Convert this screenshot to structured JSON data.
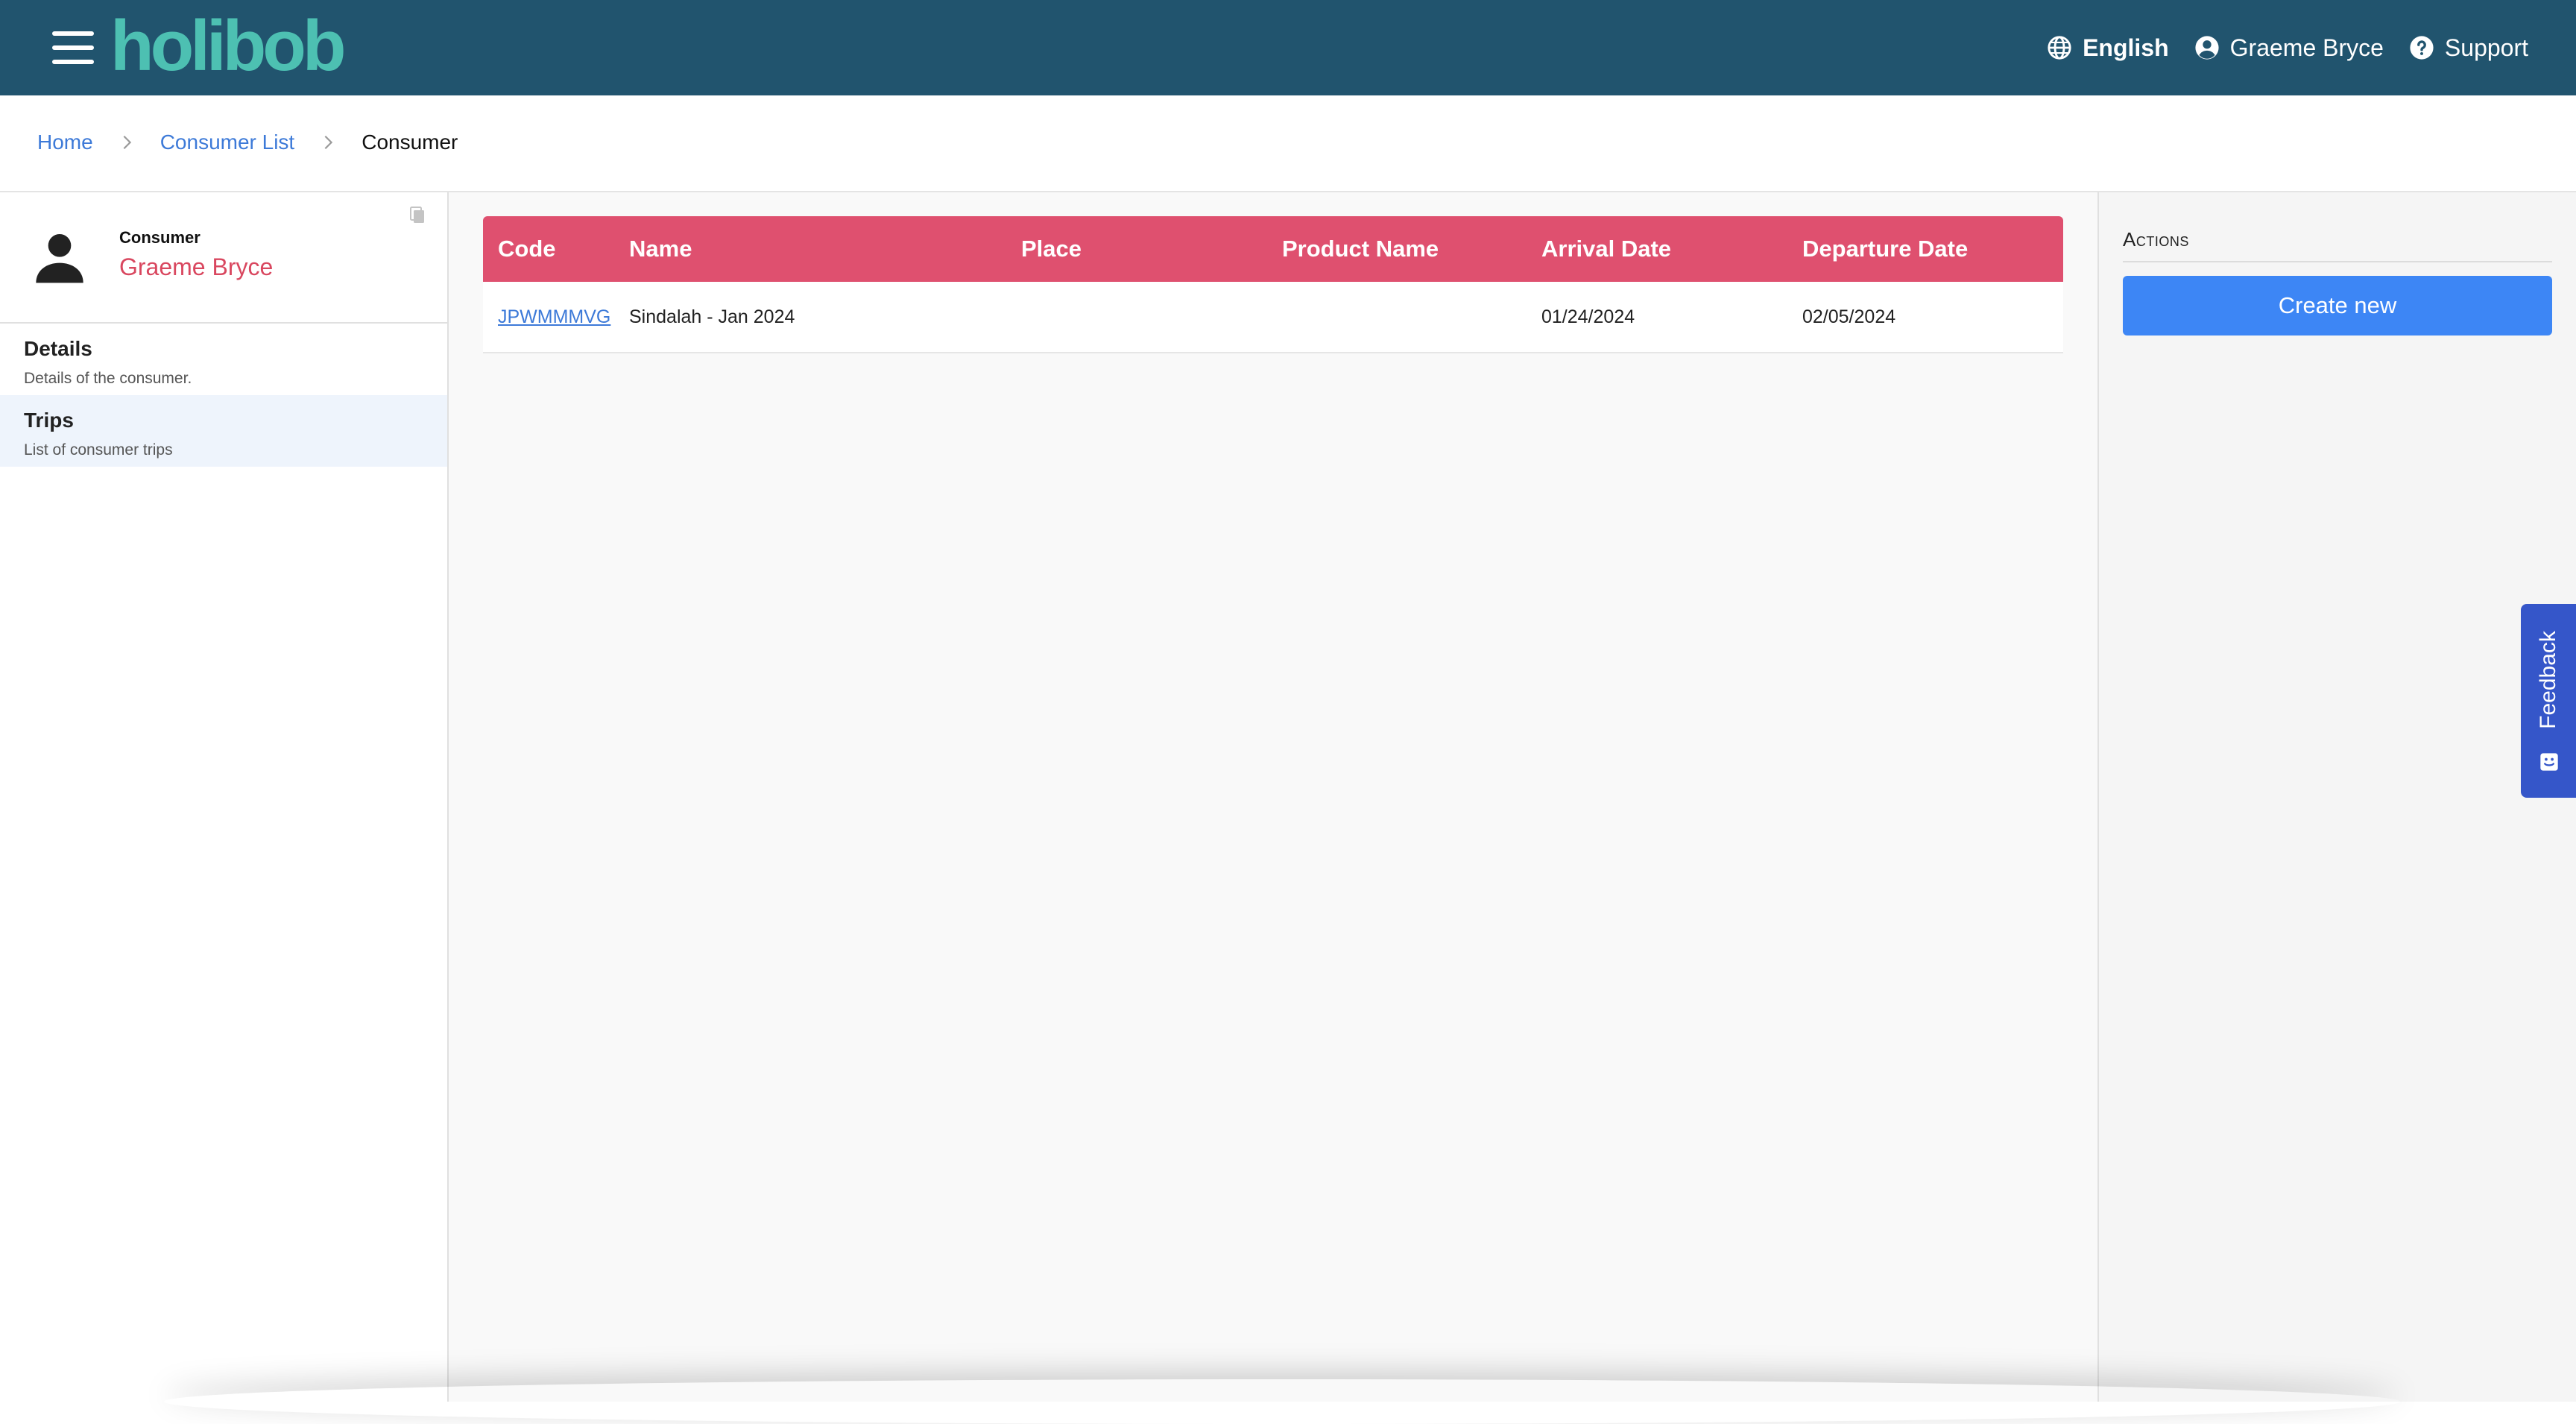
{
  "header": {
    "logo": "holibob",
    "language": "English",
    "user": "Graeme Bryce",
    "support": "Support"
  },
  "breadcrumb": {
    "home": "Home",
    "consumer_list": "Consumer List",
    "current": "Consumer"
  },
  "sidebar": {
    "consumer_label": "Consumer",
    "consumer_name": "Graeme Bryce",
    "items": [
      {
        "title": "Details",
        "subtitle": "Details of the consumer."
      },
      {
        "title": "Trips",
        "subtitle": "List of consumer trips"
      }
    ]
  },
  "table": {
    "headers": [
      "Code",
      "Name",
      "Place",
      "Product Name",
      "Arrival Date",
      "Departure Date"
    ],
    "rows": [
      {
        "code": "JPWMMMVG",
        "name": "Sindalah - Jan 2024",
        "place": "",
        "product_name": "",
        "arrival_date": "01/24/2024",
        "departure_date": "02/05/2024"
      }
    ]
  },
  "actions": {
    "title": "Actions",
    "create_label": "Create new"
  },
  "feedback": {
    "label": "Feedback"
  },
  "colors": {
    "topbar": "#21546e",
    "logo": "#4dc0b2",
    "table_header": "#df506f",
    "accent_name": "#d9475f",
    "link": "#3d7ad8",
    "primary_button": "#3d86f5",
    "feedback_tab": "#3556c9"
  }
}
